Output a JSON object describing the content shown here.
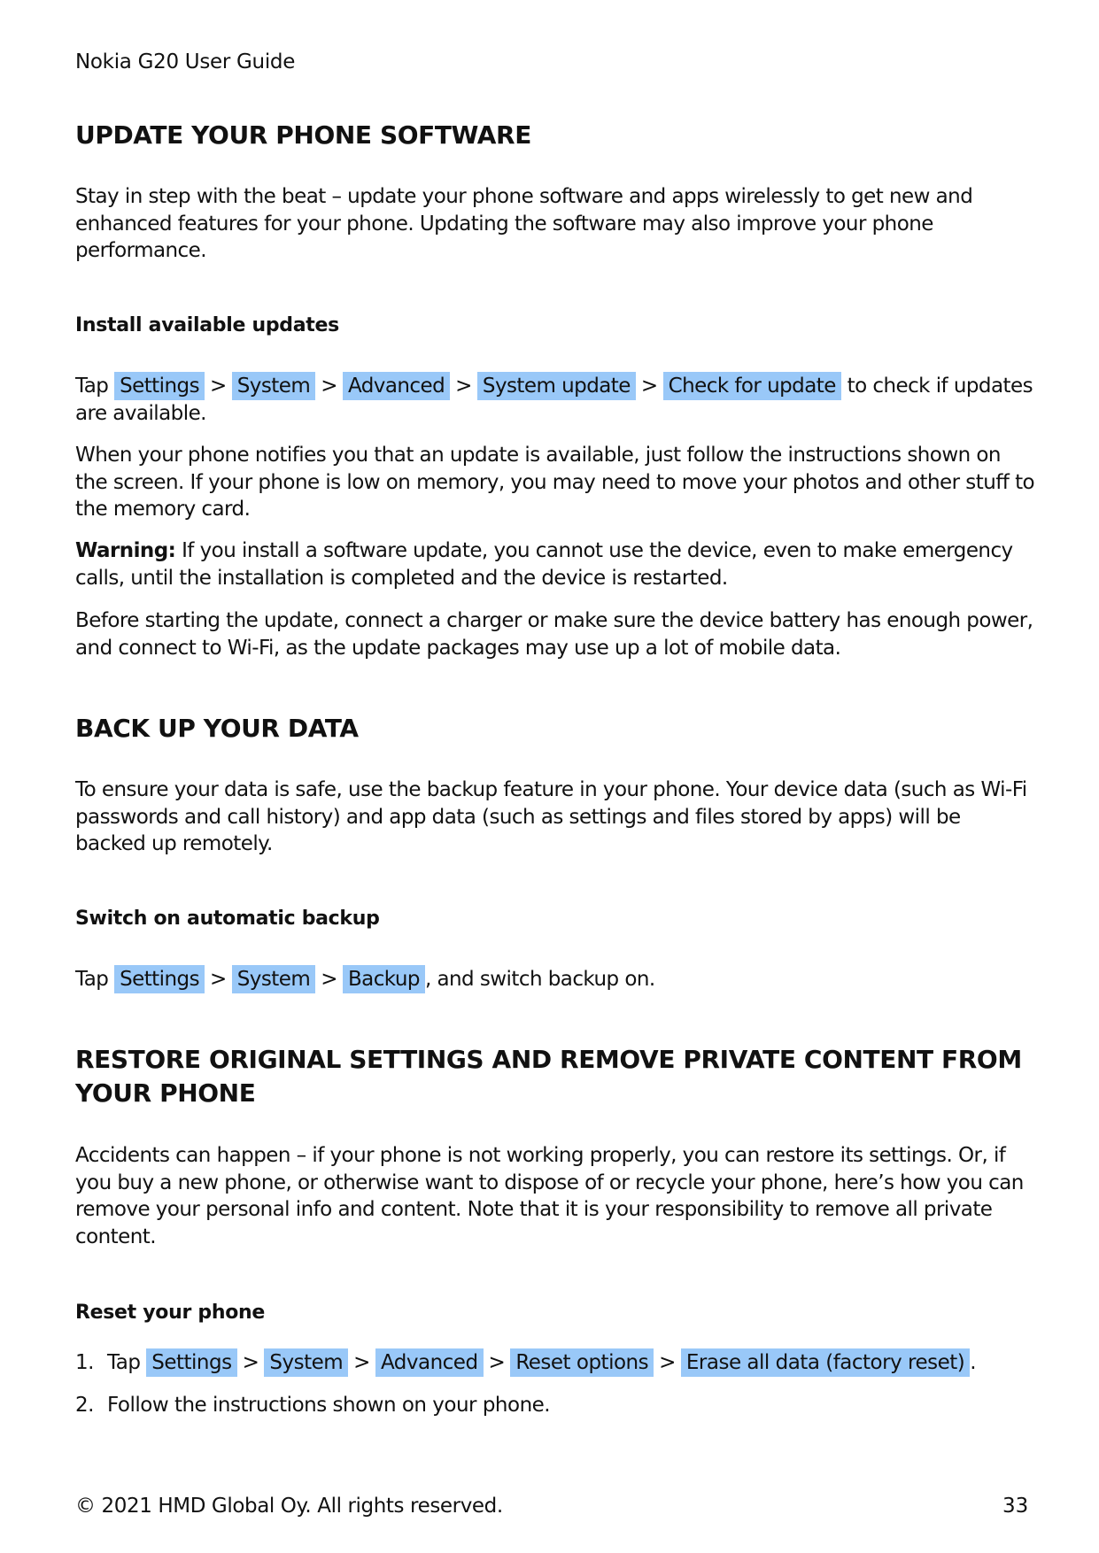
{
  "header": {
    "title": "Nokia G20 User Guide"
  },
  "sections": [
    {
      "heading": "UPDATE YOUR PHONE SOFTWARE",
      "intro": "Stay in step with the beat – update your phone software and apps wirelessly to get new and enhanced features for your phone.  Updating the software may also improve your phone performance.",
      "subheading": "Install available updates",
      "path_prefix": "Tap",
      "path": [
        "Settings",
        "System",
        "Advanced",
        "System update",
        "Check for update"
      ],
      "path_suffix": "to check if updates are available.",
      "paragraphs": [
        "When your phone notifies you that an update is available, just follow the instructions shown on the screen.  If your phone is low on memory, you may need to move your photos and other stuff to the memory card."
      ],
      "warning_label": "Warning:",
      "warning_text": " If you install a software update, you cannot use the device, even to make emergency calls, until the installation is completed and the device is restarted.",
      "closing": "Before starting the update, connect a charger or make sure the device battery has enough power, and connect to Wi-Fi, as the update packages may use up a lot of mobile data."
    },
    {
      "heading": "BACK UP YOUR DATA",
      "intro": "To ensure your data is safe, use the backup feature in your phone.  Your device data (such as Wi-Fi passwords and call history) and app data (such as settings and files stored by apps) will be backed up remotely.",
      "subheading": "Switch on automatic backup",
      "path_prefix": "Tap",
      "path": [
        "Settings",
        "System",
        "Backup"
      ],
      "path_suffix": ", and switch backup on."
    },
    {
      "heading": "RESTORE ORIGINAL SETTINGS AND REMOVE PRIVATE CONTENT FROM YOUR PHONE",
      "intro": "Accidents can happen – if your phone is not working properly, you can restore its settings.  Or, if you buy a new phone, or otherwise want to dispose of or recycle your phone, here’s how you can remove your personal info and content.  Note that it is your responsibility to remove all private content.",
      "subheading": "Reset your phone",
      "steps": [
        {
          "num": "1.",
          "prefix": "Tap",
          "path": [
            "Settings",
            "System",
            "Advanced",
            "Reset options",
            "Erase all data (factory reset)"
          ],
          "suffix": "."
        },
        {
          "num": "2.",
          "text": "Follow the instructions shown on your phone."
        }
      ]
    }
  ],
  "separator": ">",
  "highlight_color": "#99c8f8",
  "footer": {
    "copyright": "© 2021 HMD Global Oy. All rights reserved.",
    "page_number": "33"
  }
}
